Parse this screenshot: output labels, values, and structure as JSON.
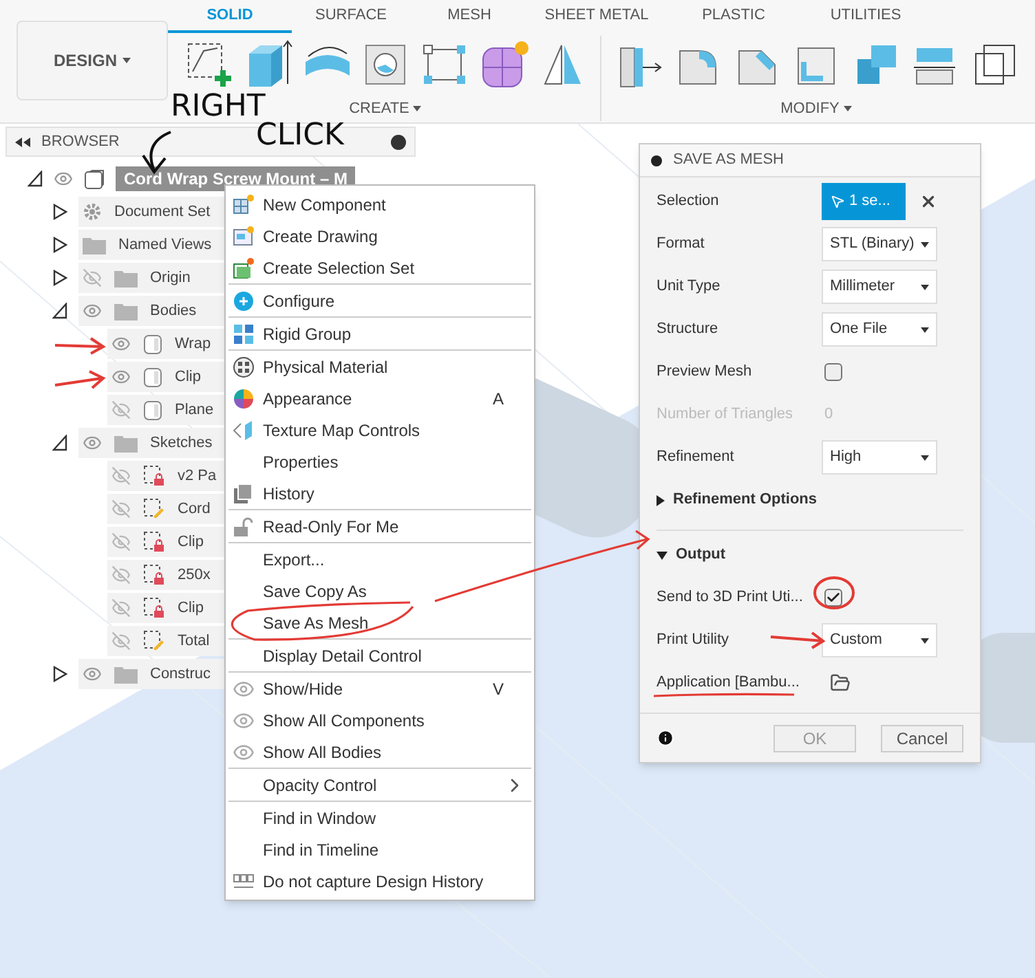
{
  "toolbar": {
    "workspace": "DESIGN",
    "tabs": [
      {
        "label": "SOLID",
        "selected": true
      },
      {
        "label": "SURFACE",
        "selected": false
      },
      {
        "label": "MESH",
        "selected": false
      },
      {
        "label": "SHEET METAL",
        "selected": false
      },
      {
        "label": "PLASTIC",
        "selected": false
      },
      {
        "label": "UTILITIES",
        "selected": false
      }
    ],
    "groups": [
      {
        "label": "CREATE"
      },
      {
        "label": "MODIFY"
      }
    ]
  },
  "annotation": {
    "lines": [
      "RIGHT",
      "CLICK"
    ]
  },
  "browser": {
    "title": "BROWSER",
    "root": {
      "label": "Cord Wrap Screw Mount – M",
      "expanded": true,
      "visible": true
    },
    "items": [
      {
        "label": "Document Set",
        "kind": "settings",
        "expanded": false
      },
      {
        "label": "Named Views",
        "kind": "folder",
        "expanded": false
      },
      {
        "label": "Origin",
        "kind": "folder",
        "visible": false,
        "expanded": false
      },
      {
        "label": "Bodies",
        "kind": "folder",
        "visible": true,
        "expanded": true,
        "children": [
          {
            "label": "Wrap",
            "kind": "body",
            "visible": true
          },
          {
            "label": "Clip",
            "kind": "body",
            "visible": true
          },
          {
            "label": "Plane",
            "kind": "body",
            "visible": false
          }
        ]
      },
      {
        "label": "Sketches",
        "kind": "folder",
        "visible": true,
        "expanded": true,
        "children": [
          {
            "label": "v2 Pa",
            "kind": "sketch_locked",
            "visible": false
          },
          {
            "label": "Cord",
            "kind": "sketch_edit",
            "visible": false
          },
          {
            "label": "Clip",
            "kind": "sketch_locked",
            "visible": false
          },
          {
            "label": "250x",
            "kind": "sketch_locked",
            "visible": false
          },
          {
            "label": "Clip",
            "kind": "sketch_locked",
            "visible": false
          },
          {
            "label": "Total",
            "kind": "sketch_edit",
            "visible": false
          }
        ]
      },
      {
        "label": "Construc",
        "kind": "folder",
        "visible": true,
        "expanded": false
      }
    ]
  },
  "context_menu": {
    "sections": [
      [
        {
          "label": "New Component"
        },
        {
          "label": "Create Drawing"
        },
        {
          "label": "Create Selection Set"
        }
      ],
      [
        {
          "label": "Configure"
        }
      ],
      [
        {
          "label": "Rigid Group"
        }
      ],
      [
        {
          "label": "Physical Material"
        },
        {
          "label": "Appearance",
          "shortcut": "A"
        },
        {
          "label": "Texture Map Controls"
        },
        {
          "label": "Properties"
        },
        {
          "label": "History"
        }
      ],
      [
        {
          "label": "Read-Only For Me"
        }
      ],
      [
        {
          "label": "Export..."
        },
        {
          "label": "Save Copy As"
        },
        {
          "label": "Save As Mesh"
        }
      ],
      [
        {
          "label": "Display Detail Control"
        }
      ],
      [
        {
          "label": "Show/Hide",
          "shortcut": "V"
        },
        {
          "label": "Show All Components"
        },
        {
          "label": "Show All Bodies"
        }
      ],
      [
        {
          "label": "Opacity Control",
          "submenu": true
        }
      ],
      [
        {
          "label": "Find in Window"
        },
        {
          "label": "Find in Timeline"
        },
        {
          "label": "Do not capture Design History"
        }
      ]
    ]
  },
  "dialog": {
    "title": "SAVE AS MESH",
    "rows": [
      {
        "kind": "selection",
        "label": "Selection",
        "value": "1 se..."
      },
      {
        "kind": "select",
        "label": "Format",
        "value": "STL (Binary)"
      },
      {
        "kind": "select",
        "label": "Unit Type",
        "value": "Millimeter"
      },
      {
        "kind": "select",
        "label": "Structure",
        "value": "One File"
      },
      {
        "kind": "checkbox",
        "label": "Preview Mesh",
        "checked": false
      },
      {
        "kind": "readout",
        "label": "Number of Triangles",
        "value": "0",
        "disabled": true
      },
      {
        "kind": "select",
        "label": "Refinement",
        "value": "High"
      }
    ],
    "sections": [
      {
        "label": "Refinement Options",
        "expanded": false
      },
      {
        "label": "Output",
        "expanded": true,
        "rows": [
          {
            "kind": "checkbox",
            "label": "Send to 3D Print Uti...",
            "checked": true
          },
          {
            "kind": "select",
            "label": "Print Utility",
            "value": "Custom"
          },
          {
            "kind": "file",
            "label": "Application [Bambu..."
          }
        ]
      }
    ],
    "buttons": [
      {
        "label": "OK",
        "disabled": true
      },
      {
        "label": "Cancel",
        "disabled": false
      }
    ]
  }
}
